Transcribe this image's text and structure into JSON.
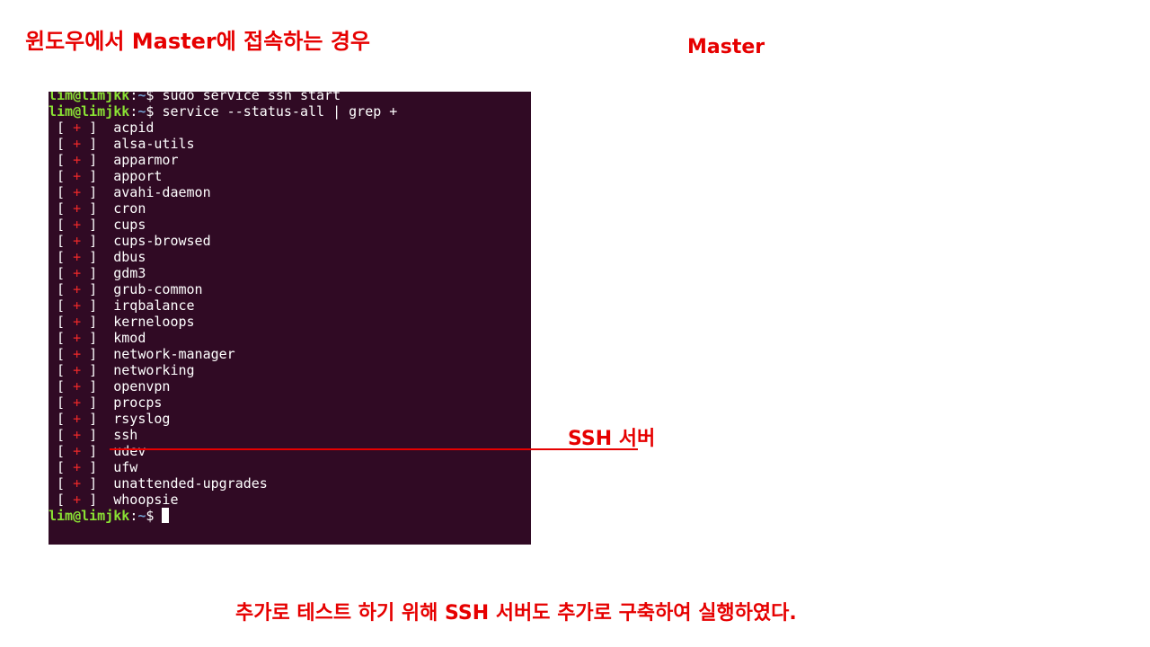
{
  "slide": {
    "title": "윈도우에서 Master에 접속하는 경우",
    "master_label": "Master",
    "ssh_callout": "SSH 서버",
    "footer": "추가로 테스트 하기 위해 SSH 서버도 추가로 구축하여 실행하였다."
  },
  "terminal": {
    "user_host": "lim@limjkk",
    "path": "~",
    "prompt_symbol": "$",
    "commands": [
      "sudo service ssh start",
      "service --status-all | grep +"
    ],
    "status_marker": "+",
    "services": [
      "acpid",
      "alsa-utils",
      "apparmor",
      "apport",
      "avahi-daemon",
      "cron",
      "cups",
      "cups-browsed",
      "dbus",
      "gdm3",
      "grub-common",
      "irqbalance",
      "kerneloops",
      "kmod",
      "network-manager",
      "networking",
      "openvpn",
      "procps",
      "rsyslog",
      "ssh",
      "udev",
      "ufw",
      "unattended-upgrades",
      "whoopsie"
    ]
  },
  "colors": {
    "accent": "#e60000",
    "terminal_bg": "#300a24",
    "prompt_user": "#8ae234",
    "prompt_path": "#729fcf",
    "status_plus": "#ef2929"
  }
}
